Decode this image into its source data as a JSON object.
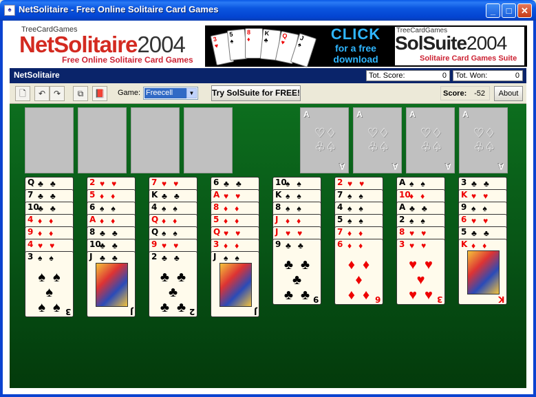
{
  "window": {
    "title": "NetSolitaire  - Free Online Solitaire Card Games"
  },
  "ad": {
    "brand_top": "TreeCardGames",
    "brand_name_a": "NetSolitaire",
    "brand_name_b": "2004",
    "brand_sub": "Free Online Solitaire Card Games",
    "banner_click": "CLICK",
    "banner_free": "for a free",
    "banner_download": "download",
    "ss_top": "TreeCardGames",
    "ss_name_a": "SolSuite",
    "ss_name_b": "2004",
    "ss_sub": "Solitaire Card Games Suite"
  },
  "app": {
    "title": "NetSolitaire",
    "tot_score_label": "Tot. Score:",
    "tot_score_value": "0",
    "tot_won_label": "Tot. Won:",
    "tot_won_value": "0",
    "game_label": "Game:",
    "game_value": "Freecell",
    "try_label": "Try SolSuite for FREE!",
    "score_label": "Score:",
    "score_value": "-52",
    "about_label": "About"
  },
  "foundations": [
    "A",
    "A",
    "A",
    "A"
  ],
  "tableau": [
    [
      {
        "r": "Q",
        "s": "♣",
        "c": "blk"
      },
      {
        "r": "7",
        "s": "♣",
        "c": "blk"
      },
      {
        "r": "10",
        "s": "♣",
        "c": "blk"
      },
      {
        "r": "4",
        "s": "♦",
        "c": "red"
      },
      {
        "r": "9",
        "s": "♦",
        "c": "red"
      },
      {
        "r": "4",
        "s": "♥",
        "c": "red"
      },
      {
        "r": "3",
        "s": "♠",
        "c": "blk"
      }
    ],
    [
      {
        "r": "2",
        "s": "♥",
        "c": "red"
      },
      {
        "r": "5",
        "s": "♦",
        "c": "red"
      },
      {
        "r": "6",
        "s": "♠",
        "c": "blk"
      },
      {
        "r": "A",
        "s": "♦",
        "c": "red"
      },
      {
        "r": "8",
        "s": "♣",
        "c": "blk"
      },
      {
        "r": "10",
        "s": "♣",
        "c": "blk"
      },
      {
        "r": "J",
        "s": "♣",
        "c": "blk"
      }
    ],
    [
      {
        "r": "7",
        "s": "♥",
        "c": "red"
      },
      {
        "r": "K",
        "s": "♣",
        "c": "blk"
      },
      {
        "r": "4",
        "s": "♠",
        "c": "blk"
      },
      {
        "r": "Q",
        "s": "♦",
        "c": "red"
      },
      {
        "r": "Q",
        "s": "♠",
        "c": "blk"
      },
      {
        "r": "9",
        "s": "♥",
        "c": "red"
      },
      {
        "r": "2",
        "s": "♣",
        "c": "blk"
      }
    ],
    [
      {
        "r": "6",
        "s": "♣",
        "c": "blk"
      },
      {
        "r": "A",
        "s": "♥",
        "c": "red"
      },
      {
        "r": "8",
        "s": "♦",
        "c": "red"
      },
      {
        "r": "5",
        "s": "♦",
        "c": "red"
      },
      {
        "r": "Q",
        "s": "♥",
        "c": "red"
      },
      {
        "r": "3",
        "s": "♦",
        "c": "red"
      },
      {
        "r": "J",
        "s": "♠",
        "c": "blk"
      }
    ],
    [
      {
        "r": "10",
        "s": "♠",
        "c": "blk"
      },
      {
        "r": "K",
        "s": "♠",
        "c": "blk"
      },
      {
        "r": "8",
        "s": "♠",
        "c": "blk"
      },
      {
        "r": "J",
        "s": "♦",
        "c": "red"
      },
      {
        "r": "J",
        "s": "♥",
        "c": "red"
      },
      {
        "r": "9",
        "s": "♣",
        "c": "blk"
      }
    ],
    [
      {
        "r": "2",
        "s": "♥",
        "c": "red"
      },
      {
        "r": "7",
        "s": "♠",
        "c": "blk"
      },
      {
        "r": "4",
        "s": "♠",
        "c": "blk"
      },
      {
        "r": "5",
        "s": "♠",
        "c": "blk"
      },
      {
        "r": "7",
        "s": "♦",
        "c": "red"
      },
      {
        "r": "6",
        "s": "♦",
        "c": "red"
      }
    ],
    [
      {
        "r": "A",
        "s": "♠",
        "c": "blk"
      },
      {
        "r": "10",
        "s": "♦",
        "c": "red"
      },
      {
        "r": "A",
        "s": "♣",
        "c": "blk"
      },
      {
        "r": "2",
        "s": "♠",
        "c": "blk"
      },
      {
        "r": "8",
        "s": "♥",
        "c": "red"
      },
      {
        "r": "3",
        "s": "♥",
        "c": "red"
      }
    ],
    [
      {
        "r": "3",
        "s": "♣",
        "c": "blk"
      },
      {
        "r": "K",
        "s": "♥",
        "c": "red"
      },
      {
        "r": "9",
        "s": "♠",
        "c": "blk"
      },
      {
        "r": "6",
        "s": "♥",
        "c": "red"
      },
      {
        "r": "5",
        "s": "♣",
        "c": "blk"
      },
      {
        "r": "K",
        "s": "♦",
        "c": "red"
      }
    ]
  ]
}
